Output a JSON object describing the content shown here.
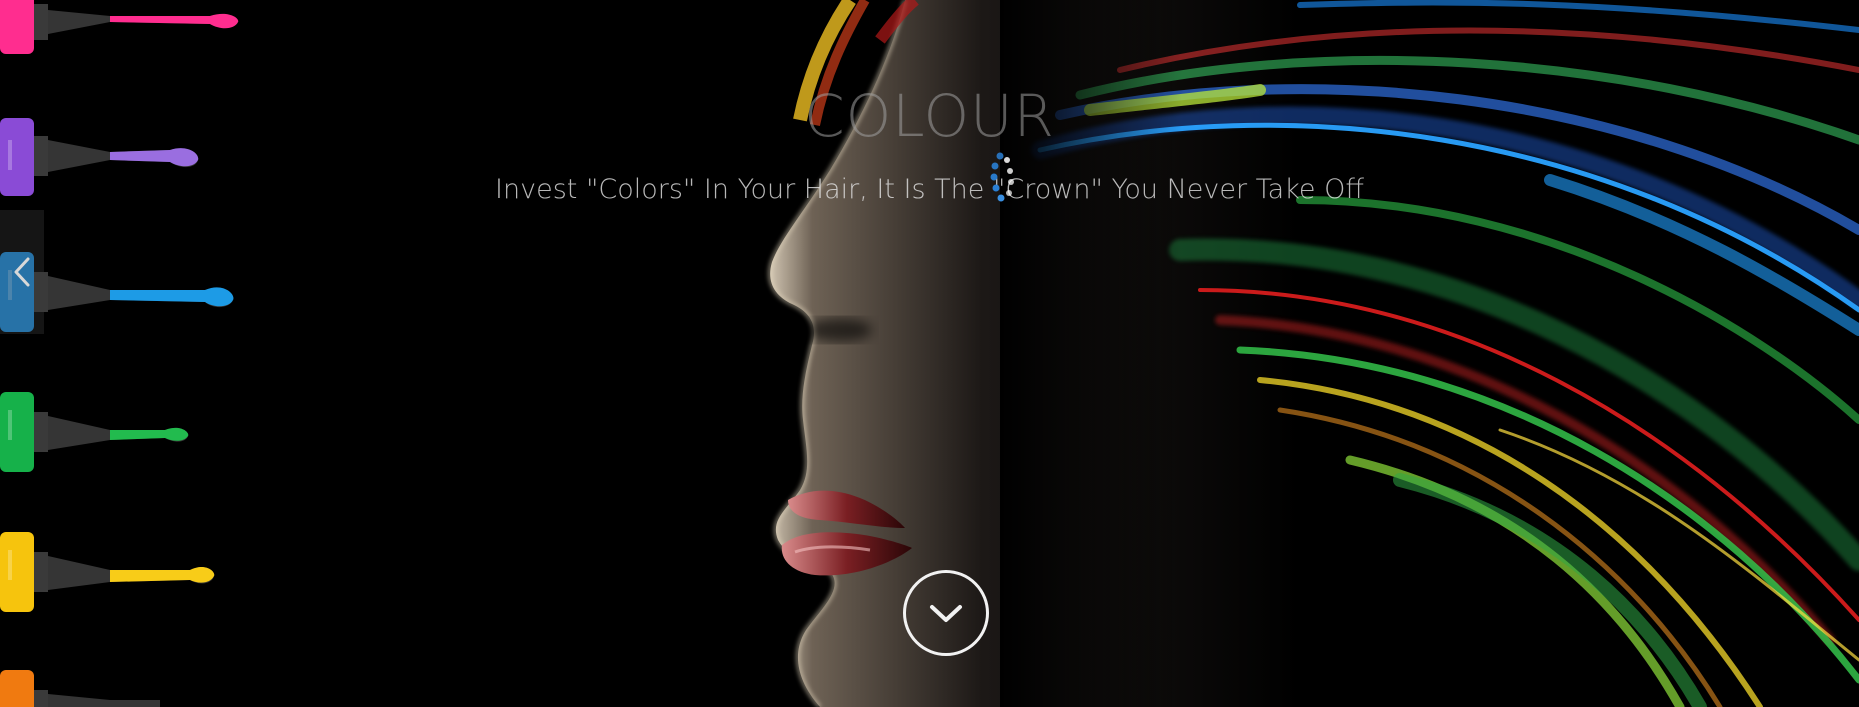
{
  "hero": {
    "title": "COLOUR",
    "subtitle": "Invest \"Colors\" In Your Hair, It Is The \"Crown\" You Never Take Off"
  },
  "controls": {
    "prev_icon": "chevron-left-icon",
    "scroll_icon": "chevron-down-icon",
    "loader_icon": "spinner-icon"
  },
  "colors": {
    "background": "#000000",
    "bottle_pink": "#ff2d8f",
    "bottle_purple": "#8a4bd6",
    "bottle_blue": "#1c8fe0",
    "bottle_green": "#16b14a",
    "bottle_yellow": "#f6c40d",
    "bottle_orange": "#f07a10"
  }
}
